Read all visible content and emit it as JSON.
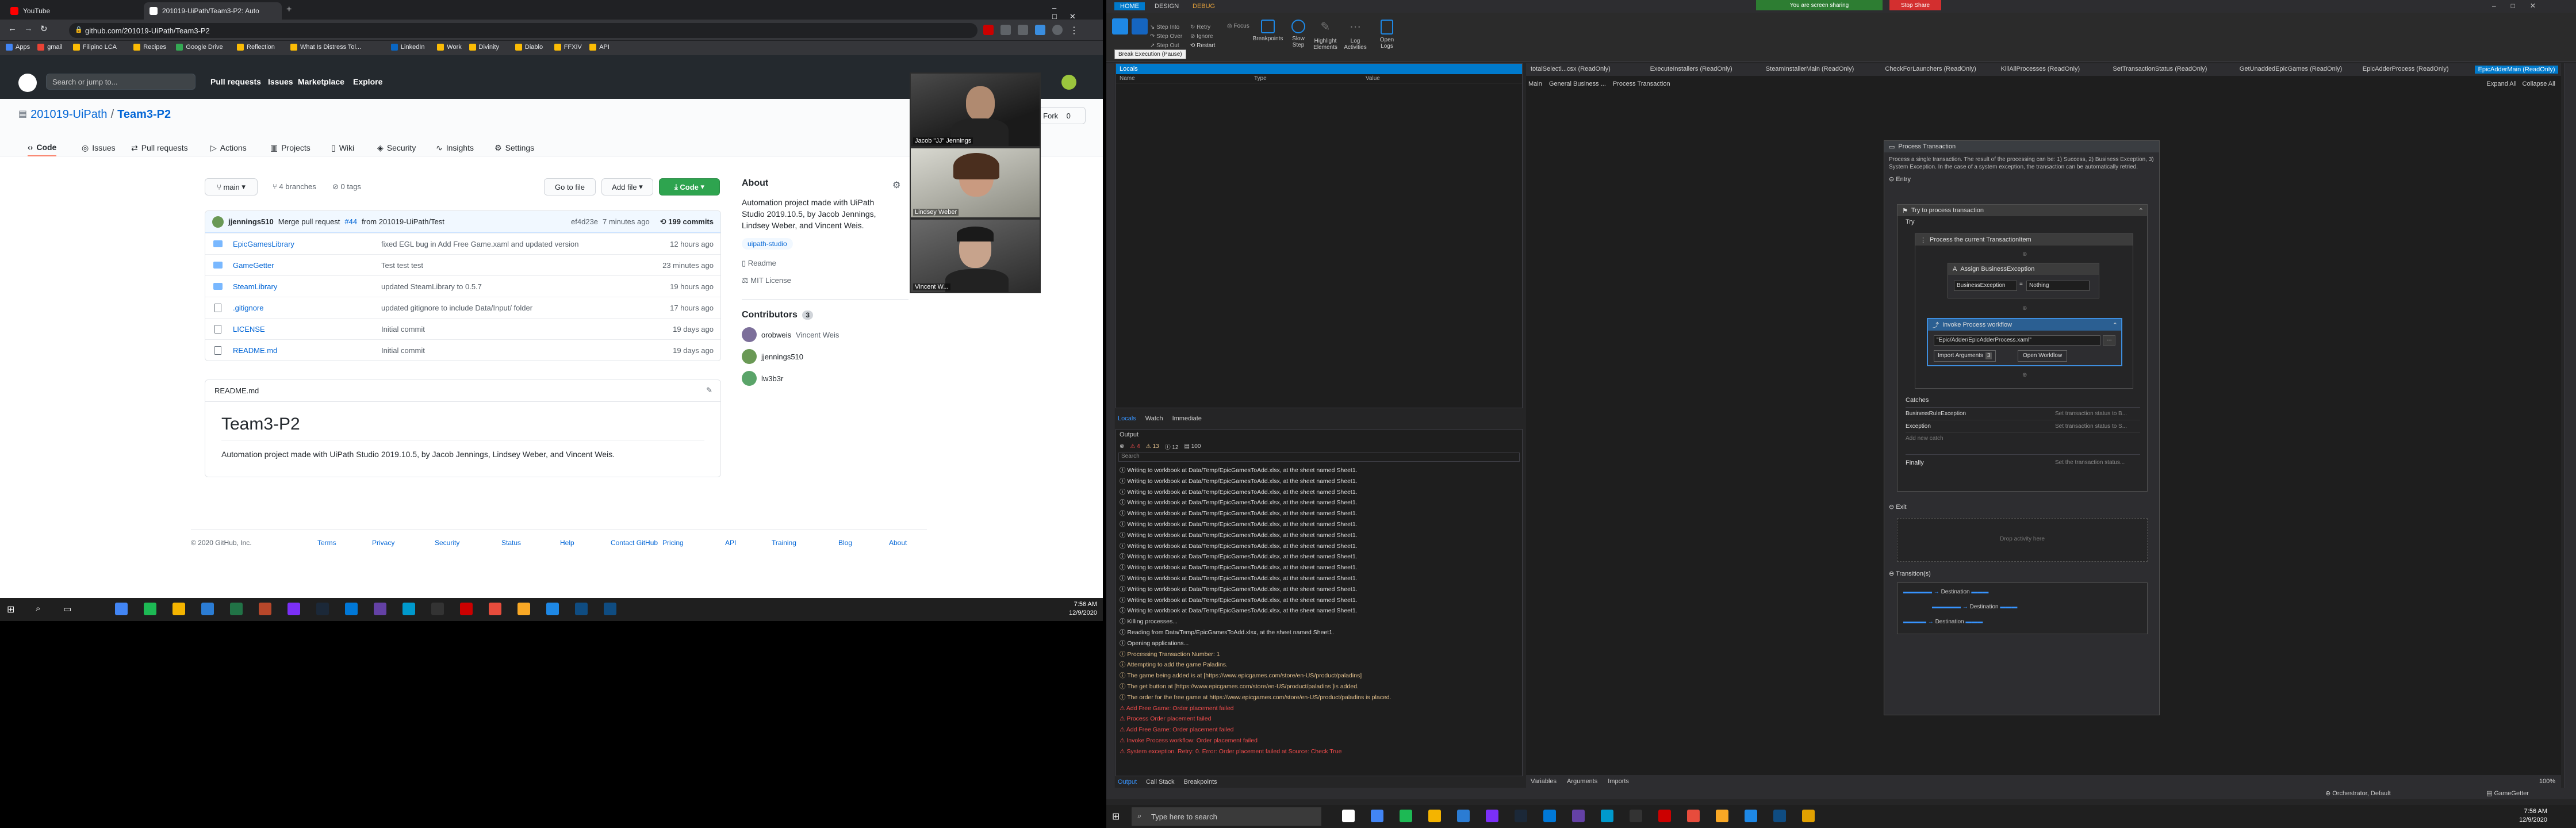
{
  "browser": {
    "tabs": [
      {
        "title": "YouTube",
        "color": "#ff0000"
      },
      {
        "title": "201019-UiPath/Team3-P2: Auto",
        "color": "#ffffff"
      }
    ],
    "url": "github.com/201019-UiPath/Team3-P2",
    "bookmarks": [
      {
        "label": "Apps",
        "color": "#4285f4"
      },
      {
        "label": "gmail",
        "color": "#ea4335"
      },
      {
        "label": "Filipino LCA",
        "color": "#fbbc05"
      },
      {
        "label": "Recipes",
        "color": "#fbbc05"
      },
      {
        "label": "Google Drive",
        "color": "#34a853"
      },
      {
        "label": "Reflection",
        "color": "#fbbc05"
      },
      {
        "label": "What Is Distress Tol...",
        "color": "#fbbc05"
      },
      {
        "label": "LinkedIn",
        "color": "#0a66c2"
      },
      {
        "label": "Work",
        "color": "#fbbc05"
      },
      {
        "label": "Divinity",
        "color": "#fbbc05"
      },
      {
        "label": "Diablo",
        "color": "#fbbc05"
      },
      {
        "label": "FFXIV",
        "color": "#fbbc05"
      },
      {
        "label": "API",
        "color": "#fbbc05"
      }
    ]
  },
  "github": {
    "search_placeholder": "Search or jump to...",
    "nav": [
      "Pull requests",
      "Issues",
      "Marketplace",
      "Explore"
    ],
    "org": "201019-UiPath",
    "repo": "Team3-P2",
    "watch_label": "Fork",
    "fork_count": "0",
    "tabs": [
      "Code",
      "Issues",
      "Pull requests",
      "Actions",
      "Projects",
      "Wiki",
      "Security",
      "Insights",
      "Settings"
    ],
    "branch": "main",
    "branches": "4 branches",
    "tags": "0 tags",
    "goto_file": "Go to file",
    "add_file": "Add file",
    "code_button": "Code",
    "commit": {
      "author": "jjennings510",
      "message_prefix": "Merge pull request",
      "pr": "#44",
      "message_suffix": "from 201019-UiPath/Test",
      "sha": "ef4d23e",
      "age": "7 minutes ago",
      "commits": "199 commits"
    },
    "files": [
      {
        "name": "EpicGamesLibrary",
        "type": "dir",
        "message": "fixed EGL bug in Add Free Game.xaml and updated version",
        "age": "12 hours ago"
      },
      {
        "name": "GameGetter",
        "type": "dir",
        "message": "Test test test",
        "age": "23 minutes ago"
      },
      {
        "name": "SteamLibrary",
        "type": "dir",
        "message": "updated SteamLibrary to 0.5.7",
        "age": "19 hours ago"
      },
      {
        "name": ".gitignore",
        "type": "file",
        "message": "updated gitignore to include Data/Input/ folder",
        "age": "17 hours ago"
      },
      {
        "name": "LICENSE",
        "type": "file",
        "message": "Initial commit",
        "age": "19 days ago"
      },
      {
        "name": "README.md",
        "type": "file",
        "message": "Initial commit",
        "age": "19 days ago"
      }
    ],
    "readme_label": "README.md",
    "readme_title": "Team3-P2",
    "readme_body": "Automation project made with UiPath Studio 2019.10.5, by Jacob Jennings, Lindsey Weber, and Vincent Weis.",
    "about_title": "About",
    "about_body": "Automation project made with UiPath Studio 2019.10.5, by Jacob Jennings, Lindsey Weber, and Vincent Weis.",
    "topic": "uipath-studio",
    "about_links": [
      "Readme",
      "MIT License"
    ],
    "contributors_title": "Contributors",
    "contributors_count": "3",
    "contributors": [
      {
        "login": "orobweis",
        "name": "Vincent Weis",
        "color": "#7c6f9a"
      },
      {
        "login": "jjennings510",
        "name": "",
        "color": "#6a9955"
      },
      {
        "login": "lw3b3r",
        "name": "",
        "color": "#5aa469"
      }
    ],
    "footer_copyright": "© 2020 GitHub, Inc.",
    "footer_links": [
      "Terms",
      "Privacy",
      "Security",
      "Status",
      "Help",
      "Contact GitHub",
      "Pricing",
      "API",
      "Training",
      "Blog",
      "About"
    ]
  },
  "webcams": [
    {
      "name": "Jacob \"JJ\" Jennings"
    },
    {
      "name": "Lindsey Weber"
    },
    {
      "name": "Vincent W..."
    }
  ],
  "taskbar_left": {
    "time": "7:56 AM",
    "date": "12/9/2020"
  },
  "uipath": {
    "ribbon_tabs": [
      "HOME",
      "DESIGN",
      "DEBUG"
    ],
    "sharing_banner": "You are screen sharing",
    "stop_share": "Stop Share",
    "ribbon_buttons": [
      {
        "label": "Step Into"
      },
      {
        "label": "Step Over"
      },
      {
        "label": "Step Out"
      },
      {
        "label": "Retry"
      },
      {
        "label": "Ignore"
      },
      {
        "label": "Restart"
      },
      {
        "label": "Focus"
      },
      {
        "label": "Breakpoints"
      },
      {
        "label": "Slow Step"
      },
      {
        "label": "Highlight Elements"
      },
      {
        "label": "Log Activities"
      },
      {
        "label": "Open Logs"
      }
    ],
    "tooltip": "Break Execution (Pause)",
    "locals": {
      "title": "Locals",
      "cols": [
        "Name",
        "Type",
        "Value"
      ]
    },
    "bottom_tabs": [
      "Locals",
      "Watch",
      "Immediate"
    ],
    "output": {
      "title": "Output",
      "filter_counts": [
        "4",
        "13",
        "12",
        "100"
      ],
      "search_placeholder": "Search",
      "lines": [
        {
          "t": "Writing to workbook at Data/Temp/EpicGamesToAdd.xlsx, at the sheet named Sheet1.",
          "k": "n"
        },
        {
          "t": "Writing to workbook at Data/Temp/EpicGamesToAdd.xlsx, at the sheet named Sheet1.",
          "k": "n"
        },
        {
          "t": "Writing to workbook at Data/Temp/EpicGamesToAdd.xlsx, at the sheet named Sheet1.",
          "k": "n"
        },
        {
          "t": "Writing to workbook at Data/Temp/EpicGamesToAdd.xlsx, at the sheet named Sheet1.",
          "k": "n"
        },
        {
          "t": "Writing to workbook at Data/Temp/EpicGamesToAdd.xlsx, at the sheet named Sheet1.",
          "k": "n"
        },
        {
          "t": "Writing to workbook at Data/Temp/EpicGamesToAdd.xlsx, at the sheet named Sheet1.",
          "k": "n"
        },
        {
          "t": "Writing to workbook at Data/Temp/EpicGamesToAdd.xlsx, at the sheet named Sheet1.",
          "k": "n"
        },
        {
          "t": "Writing to workbook at Data/Temp/EpicGamesToAdd.xlsx, at the sheet named Sheet1.",
          "k": "n"
        },
        {
          "t": "Writing to workbook at Data/Temp/EpicGamesToAdd.xlsx, at the sheet named Sheet1.",
          "k": "n"
        },
        {
          "t": "Writing to workbook at Data/Temp/EpicGamesToAdd.xlsx, at the sheet named Sheet1.",
          "k": "n"
        },
        {
          "t": "Writing to workbook at Data/Temp/EpicGamesToAdd.xlsx, at the sheet named Sheet1.",
          "k": "n"
        },
        {
          "t": "Writing to workbook at Data/Temp/EpicGamesToAdd.xlsx, at the sheet named Sheet1.",
          "k": "n"
        },
        {
          "t": "Writing to workbook at Data/Temp/EpicGamesToAdd.xlsx, at the sheet named Sheet1.",
          "k": "n"
        },
        {
          "t": "Writing to workbook at Data/Temp/EpicGamesToAdd.xlsx, at the sheet named Sheet1.",
          "k": "n"
        },
        {
          "t": "Killing processes...",
          "k": "n"
        },
        {
          "t": "Reading from Data/Temp/EpicGamesToAdd.xlsx, at the sheet named Sheet1.",
          "k": "n"
        },
        {
          "t": "Opening applications...",
          "k": "n"
        },
        {
          "t": "Processing Transaction Number: 1",
          "k": "w"
        },
        {
          "t": "Attempting to add the game Paladins.",
          "k": "w"
        },
        {
          "t": "The game being added is at [https://www.epicgames.com/store/en-US/product/paladins]",
          "k": "w"
        },
        {
          "t": "The get button at [https://www.epicgames.com/store/en-US/product/paladins ]is added.",
          "k": "w"
        },
        {
          "t": "The order for the free game at https://www.epicgames.com/store/en-US/product/paladins is placed.",
          "k": "w"
        },
        {
          "t": "Add Free Game: Order placement failed",
          "k": "e"
        },
        {
          "t": "Process Order placement failed",
          "k": "e"
        },
        {
          "t": "Add Free Game: Order placement failed",
          "k": "e"
        },
        {
          "t": "Invoke Process workflow: Order placement failed",
          "k": "e"
        },
        {
          "t": "System exception. Retry: 0. Error: Order placement failed at Source: Check True",
          "k": "e"
        }
      ]
    },
    "output_tabs": [
      "Output",
      "Call Stack",
      "Breakpoints"
    ],
    "doc_tabs": [
      "totalSelecti...csx (ReadOnly)",
      "ExecuteInstallers (ReadOnly)",
      "SteamInstallerMain (ReadOnly)",
      "CheckForLaunchers (ReadOnly)",
      "KillAllProcesses (ReadOnly)",
      "SetTransactionStatus (ReadOnly)",
      "GetUnaddedEpicGames (ReadOnly)",
      "EpicAdderProcess (ReadOnly)",
      "EpicAdderMain (ReadOnly)"
    ],
    "breadcrumb": [
      "Main",
      "General Business ...",
      "Process Transaction"
    ],
    "expand_all": "Expand All",
    "collapse_all": "Collapse All",
    "designer": {
      "outer_title": "Process Transaction",
      "outer_desc": "Process a single transaction. The result of the processing can be: 1) Success, 2) Business Exception, 3) System Exception. In the case of a system exception, the transaction can be automatically retried.",
      "entry": "Entry",
      "try_catch": "Try to process transaction",
      "try": "Try",
      "sequence": "Process the current TransactionItem",
      "assign": "Assign BusinessException",
      "assign_to": "BusinessException",
      "assign_value": "Nothing",
      "invoke": "Invoke Process workflow",
      "invoke_path": "\"Epic/Adder/EpicAdderProcess.xaml\"",
      "import_args": "Import Arguments",
      "import_count": "3",
      "open_workflow": "Open Workflow",
      "catches": "Catches",
      "catch_rows": [
        {
          "ex": "BusinessRuleException",
          "hint": "Set transaction status to B..."
        },
        {
          "ex": "Exception",
          "hint": "Set transaction status to S..."
        }
      ],
      "add_catch": "Add new catch",
      "finally": "Finally",
      "finally_hint": "Set the transaction status...",
      "exit": "Exit",
      "drop_hint": "Drop activity here",
      "transitions": "Transition(s)",
      "destination": "Destination"
    },
    "bottom_doc_tabs": [
      "Variables",
      "Arguments",
      "Imports"
    ],
    "zoom": "100%",
    "status_right": [
      "Orchestrator, Default",
      "GameGetter"
    ],
    "taskbar": {
      "search": "Type here to search",
      "time": "7:56 AM",
      "date": "12/9/2020"
    }
  }
}
